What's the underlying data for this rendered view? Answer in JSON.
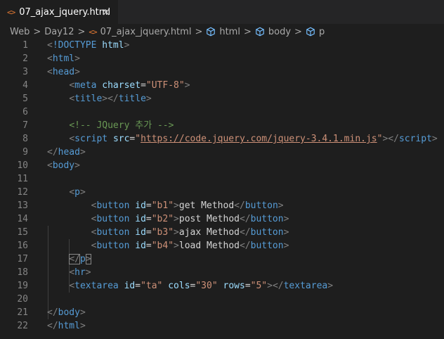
{
  "tab": {
    "icon": "<>",
    "title": "07_ajax_jquery.html",
    "close": "×"
  },
  "breadcrumb": {
    "items": [
      {
        "label": "Web"
      },
      {
        "label": "Day12"
      },
      {
        "label": "07_ajax_jquery.html",
        "icon": "html-file-icon"
      },
      {
        "label": "html",
        "icon": "cube-icon"
      },
      {
        "label": "body",
        "icon": "cube-icon"
      },
      {
        "label": "p",
        "icon": "cube-icon"
      }
    ],
    "separator": ">"
  },
  "lines": [
    {
      "n": "1",
      "segs": [
        [
          "b",
          "<"
        ],
        [
          "t",
          "!DOCTYPE "
        ],
        [
          "a",
          "html"
        ],
        [
          "b",
          ">"
        ]
      ]
    },
    {
      "n": "2",
      "segs": [
        [
          "b",
          "<"
        ],
        [
          "t",
          "html"
        ],
        [
          "b",
          ">"
        ]
      ]
    },
    {
      "n": "3",
      "segs": [
        [
          "b",
          "<"
        ],
        [
          "t",
          "head"
        ],
        [
          "b",
          ">"
        ]
      ]
    },
    {
      "n": "4",
      "segs": [
        [
          "x",
          "    "
        ],
        [
          "b",
          "<"
        ],
        [
          "t",
          "meta "
        ],
        [
          "a",
          "charset"
        ],
        [
          "x",
          "="
        ],
        [
          "s",
          "\"UTF-8\""
        ],
        [
          "b",
          ">"
        ]
      ]
    },
    {
      "n": "5",
      "segs": [
        [
          "x",
          "    "
        ],
        [
          "b",
          "<"
        ],
        [
          "t",
          "title"
        ],
        [
          "b",
          "></"
        ],
        [
          "t",
          "title"
        ],
        [
          "b",
          ">"
        ]
      ]
    },
    {
      "n": "6",
      "segs": []
    },
    {
      "n": "7",
      "segs": [
        [
          "x",
          "    "
        ],
        [
          "c",
          "<!-- JQuery 추가 -->"
        ]
      ]
    },
    {
      "n": "8",
      "segs": [
        [
          "x",
          "    "
        ],
        [
          "b",
          "<"
        ],
        [
          "t",
          "script "
        ],
        [
          "a",
          "src"
        ],
        [
          "x",
          "="
        ],
        [
          "s",
          "\""
        ],
        [
          "u",
          "https://code.jquery.com/jquery-3.4.1.min.js"
        ],
        [
          "s",
          "\""
        ],
        [
          "b",
          "></"
        ],
        [
          "t",
          "script"
        ],
        [
          "b",
          ">"
        ]
      ]
    },
    {
      "n": "9",
      "segs": [
        [
          "b",
          "</"
        ],
        [
          "t",
          "head"
        ],
        [
          "b",
          ">"
        ]
      ]
    },
    {
      "n": "10",
      "segs": [
        [
          "b",
          "<"
        ],
        [
          "t",
          "body"
        ],
        [
          "b",
          ">"
        ]
      ]
    },
    {
      "n": "11",
      "segs": []
    },
    {
      "n": "12",
      "segs": [
        [
          "x",
          "    "
        ],
        [
          "b",
          "<"
        ],
        [
          "t",
          "p"
        ],
        [
          "b",
          ">"
        ]
      ]
    },
    {
      "n": "13",
      "segs": [
        [
          "x",
          "        "
        ],
        [
          "b",
          "<"
        ],
        [
          "t",
          "button "
        ],
        [
          "a",
          "id"
        ],
        [
          "x",
          "="
        ],
        [
          "s",
          "\"b1\""
        ],
        [
          "b",
          ">"
        ],
        [
          "x",
          "get Method"
        ],
        [
          "b",
          "</"
        ],
        [
          "t",
          "button"
        ],
        [
          "b",
          ">"
        ]
      ]
    },
    {
      "n": "14",
      "segs": [
        [
          "x",
          "        "
        ],
        [
          "b",
          "<"
        ],
        [
          "t",
          "button "
        ],
        [
          "a",
          "id"
        ],
        [
          "x",
          "="
        ],
        [
          "s",
          "\"b2\""
        ],
        [
          "b",
          ">"
        ],
        [
          "x",
          "post Method"
        ],
        [
          "b",
          "</"
        ],
        [
          "t",
          "button"
        ],
        [
          "b",
          ">"
        ]
      ]
    },
    {
      "n": "15",
      "segs": [
        [
          "x",
          "        "
        ],
        [
          "b",
          "<"
        ],
        [
          "t",
          "button "
        ],
        [
          "a",
          "id"
        ],
        [
          "x",
          "="
        ],
        [
          "s",
          "\"b3\""
        ],
        [
          "b",
          ">"
        ],
        [
          "x",
          "ajax Method"
        ],
        [
          "b",
          "</"
        ],
        [
          "t",
          "button"
        ],
        [
          "b",
          ">"
        ]
      ]
    },
    {
      "n": "16",
      "segs": [
        [
          "x",
          "        "
        ],
        [
          "b",
          "<"
        ],
        [
          "t",
          "button "
        ],
        [
          "a",
          "id"
        ],
        [
          "x",
          "="
        ],
        [
          "s",
          "\"b4\""
        ],
        [
          "b",
          ">"
        ],
        [
          "x",
          "load Method"
        ],
        [
          "b",
          "</"
        ],
        [
          "t",
          "button"
        ],
        [
          "b",
          ">"
        ]
      ]
    },
    {
      "n": "17",
      "segs": [
        [
          "x",
          "    "
        ],
        [
          "b",
          "</"
        ],
        [
          "t",
          "p"
        ],
        [
          "b",
          ">"
        ]
      ]
    },
    {
      "n": "18",
      "segs": [
        [
          "x",
          "    "
        ],
        [
          "b",
          "<"
        ],
        [
          "t",
          "hr"
        ],
        [
          "b",
          ">"
        ]
      ]
    },
    {
      "n": "19",
      "segs": [
        [
          "x",
          "    "
        ],
        [
          "b",
          "<"
        ],
        [
          "t",
          "textarea "
        ],
        [
          "a",
          "id"
        ],
        [
          "x",
          "="
        ],
        [
          "s",
          "\"ta\""
        ],
        [
          "x",
          " "
        ],
        [
          "a",
          "cols"
        ],
        [
          "x",
          "="
        ],
        [
          "s",
          "\"30\""
        ],
        [
          "x",
          " "
        ],
        [
          "a",
          "rows"
        ],
        [
          "x",
          "="
        ],
        [
          "s",
          "\"5\""
        ],
        [
          "b",
          "></"
        ],
        [
          "t",
          "textarea"
        ],
        [
          "b",
          ">"
        ]
      ]
    },
    {
      "n": "20",
      "segs": []
    },
    {
      "n": "21",
      "segs": [
        [
          "b",
          "</"
        ],
        [
          "t",
          "body"
        ],
        [
          "b",
          ">"
        ]
      ]
    },
    {
      "n": "22",
      "segs": [
        [
          "b",
          "</"
        ],
        [
          "t",
          "html"
        ],
        [
          "b",
          ">"
        ]
      ]
    }
  ],
  "colors": {
    "background": "#1e1e1e",
    "tag": "#569cd6",
    "attribute": "#9cdcfe",
    "string": "#ce9178",
    "comment": "#6a9955",
    "line_number": "#858585"
  }
}
